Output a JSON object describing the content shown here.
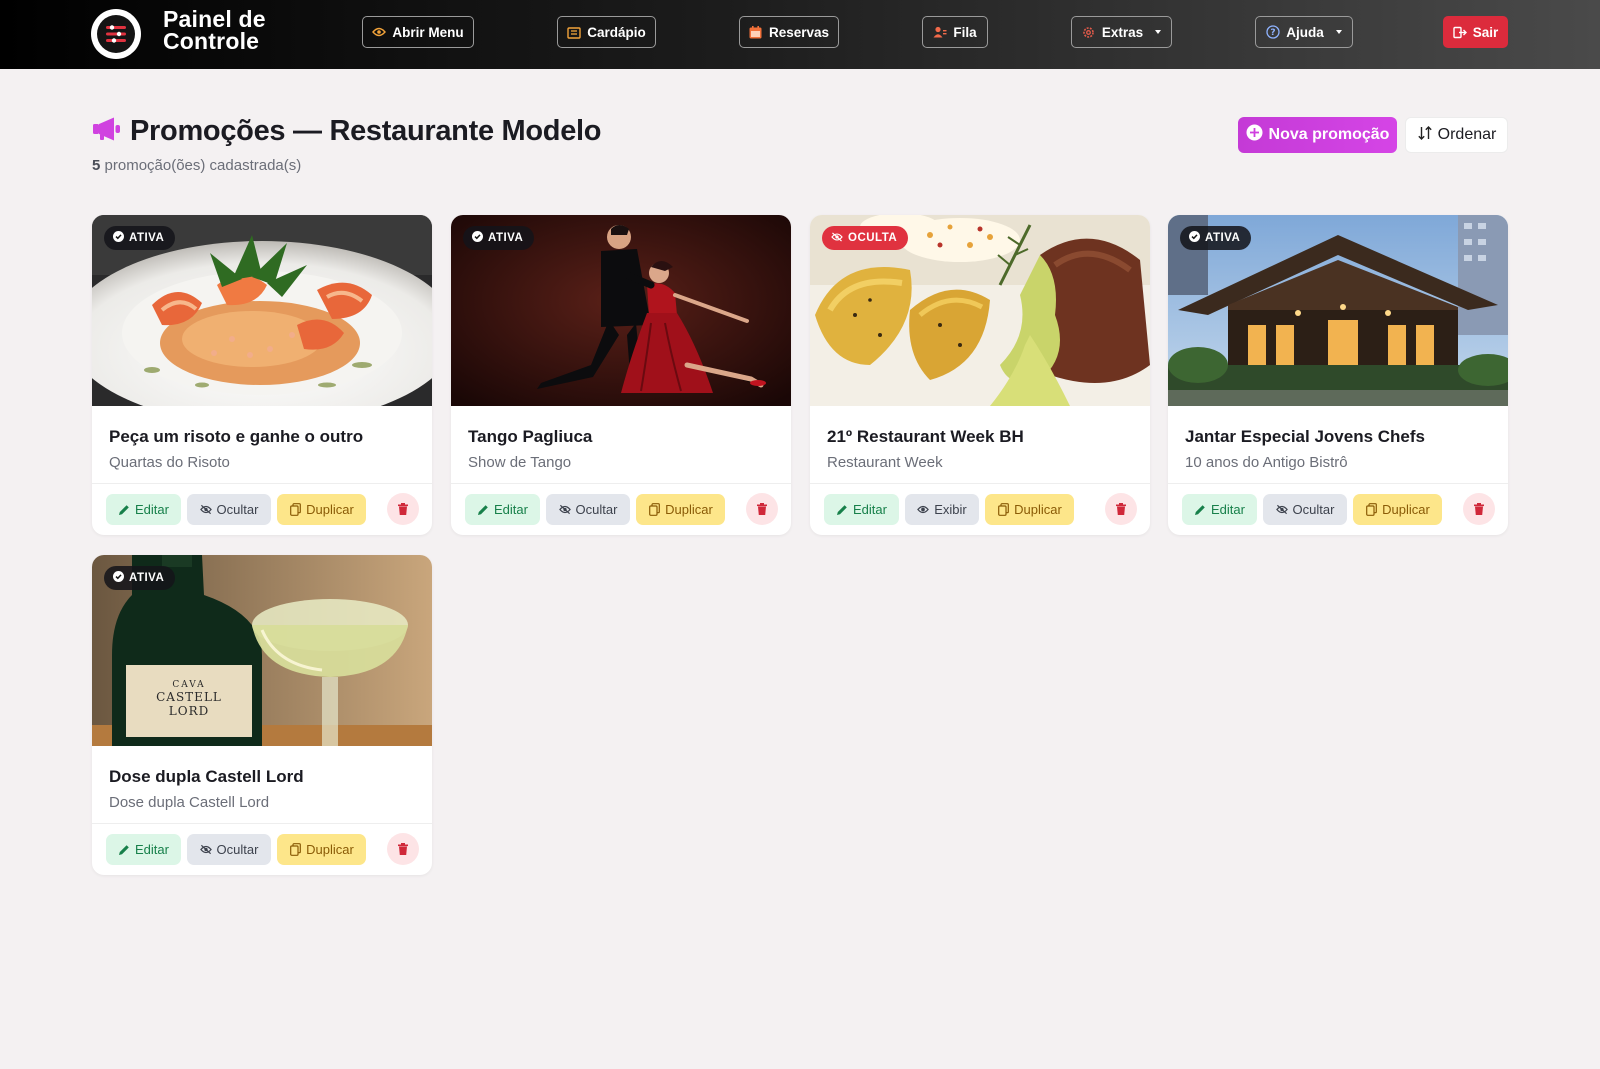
{
  "app": {
    "title_line1": "Painel de",
    "title_line2": "Controle"
  },
  "nav": {
    "open_menu": "Abrir Menu",
    "cardapio": "Cardápio",
    "reservas": "Reservas",
    "fila": "Fila",
    "extras": "Extras",
    "ajuda": "Ajuda",
    "sair": "Sair"
  },
  "header": {
    "title": "Promoções — Restaurante Modelo",
    "count": "5",
    "count_suffix": "promoção(ões) cadastrada(s)",
    "new_button": "Nova promoção",
    "order_button": "Ordenar"
  },
  "cards": [
    {
      "status": "ATIVA",
      "title": "Peça um risoto e ganhe o outro",
      "subtitle": "Quartas do Risoto",
      "edit": "Editar",
      "toggle": "Ocultar",
      "duplicate": "Duplicar"
    },
    {
      "status": "ATIVA",
      "title": "Tango Pagliuca",
      "subtitle": "Show de Tango",
      "edit": "Editar",
      "toggle": "Ocultar",
      "duplicate": "Duplicar"
    },
    {
      "status": "OCULTA",
      "title": "21º Restaurant Week BH",
      "subtitle": "Restaurant Week",
      "edit": "Editar",
      "toggle": "Exibir",
      "duplicate": "Duplicar"
    },
    {
      "status": "ATIVA",
      "title": "Jantar Especial Jovens Chefs",
      "subtitle": "10 anos do Antigo Bistrô",
      "edit": "Editar",
      "toggle": "Ocultar",
      "duplicate": "Duplicar"
    },
    {
      "status": "ATIVA",
      "title": "Dose dupla Castell Lord",
      "subtitle": "Dose dupla Castell Lord",
      "edit": "Editar",
      "toggle": "Ocultar",
      "duplicate": "Duplicar",
      "label_text": "CAVA CASTELL LORD"
    }
  ],
  "colors": {
    "accent_magenta": "#d042e0",
    "danger": "#dc2b3c",
    "success_bg": "#dcf6e7",
    "warning_bg": "#fde68a"
  }
}
